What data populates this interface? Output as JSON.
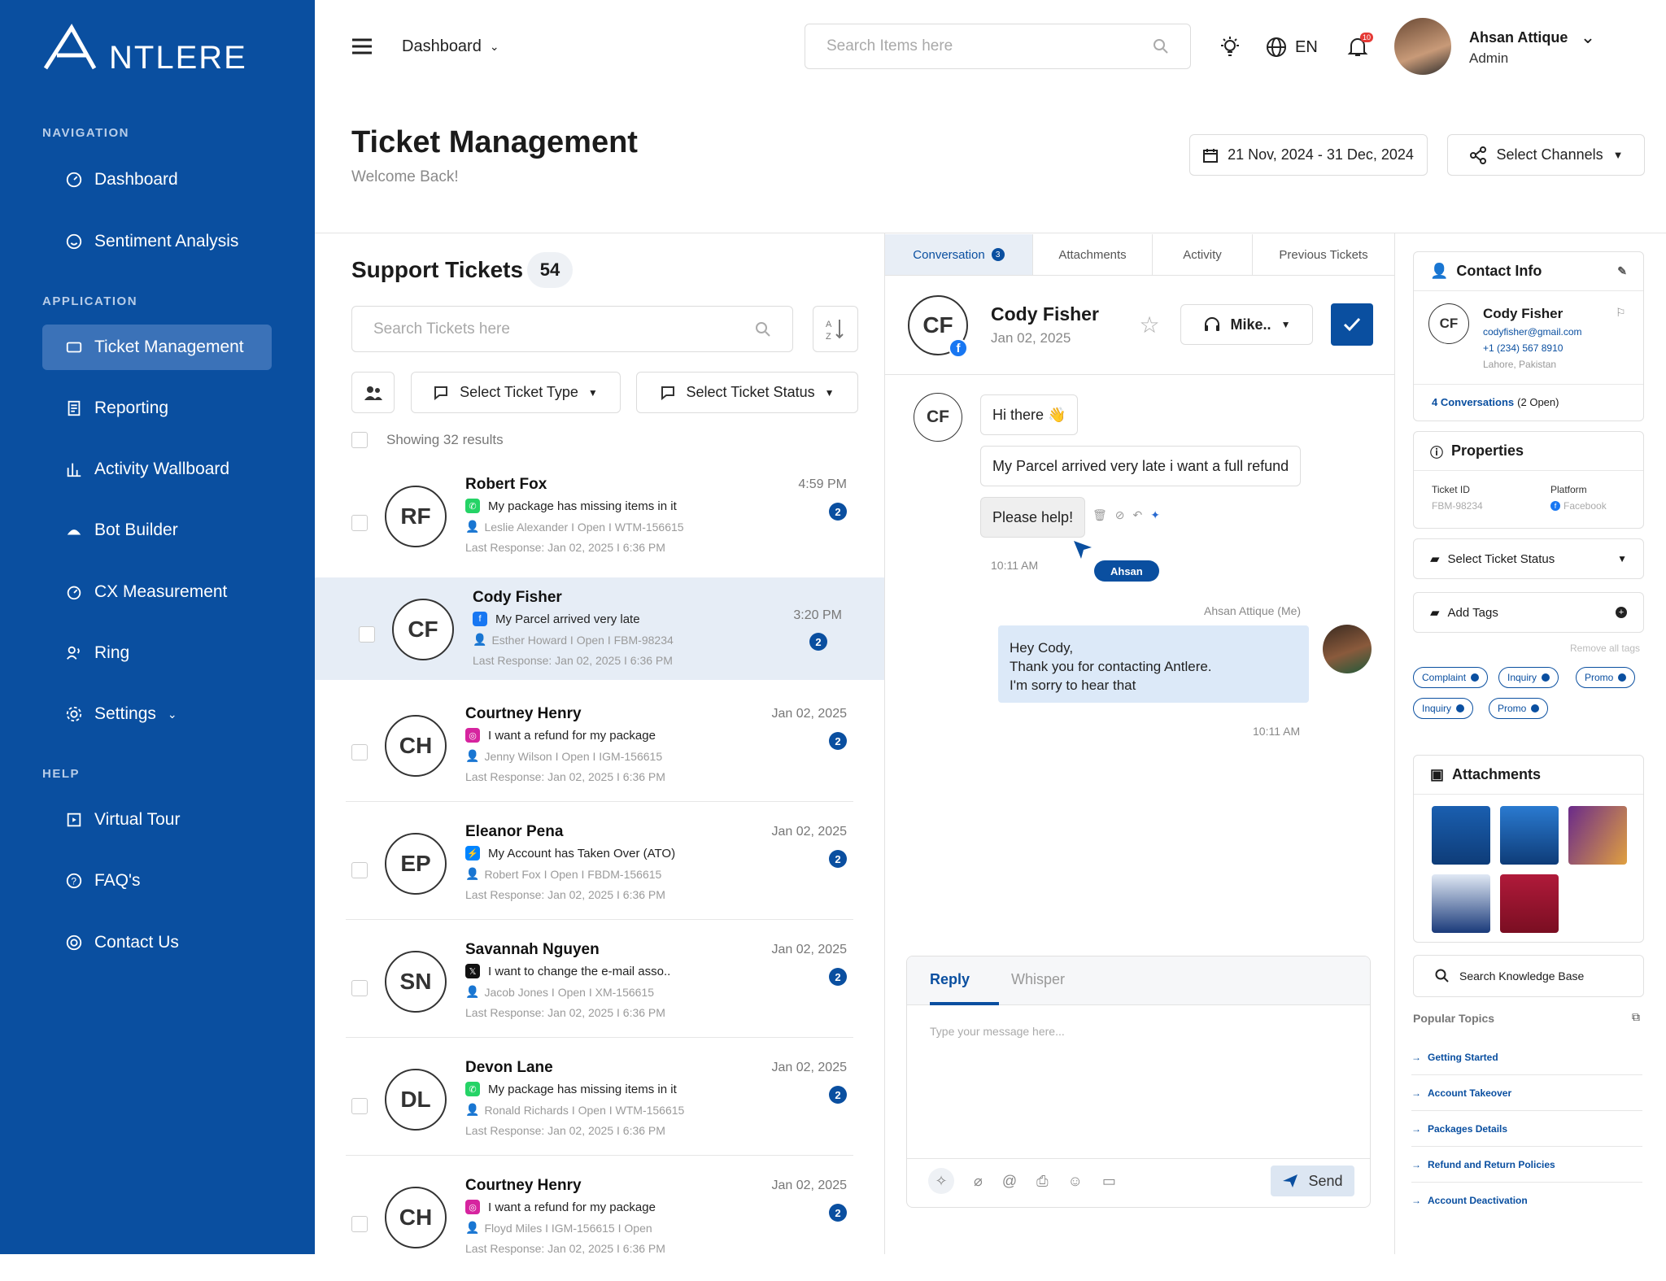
{
  "app": {
    "brand_rest": "NTLERE"
  },
  "sidebar": {
    "sec_nav": "NAVIGATION",
    "sec_app": "APPLICATION",
    "sec_help": "HELP",
    "items": [
      {
        "label": "Dashboard"
      },
      {
        "label": "Sentiment Analysis"
      },
      {
        "label": "Ticket Management"
      },
      {
        "label": "Reporting"
      },
      {
        "label": "Activity Wallboard"
      },
      {
        "label": "Bot Builder"
      },
      {
        "label": "CX Measurement"
      },
      {
        "label": "Ring"
      },
      {
        "label": "Settings"
      },
      {
        "label": "Virtual Tour"
      },
      {
        "label": "FAQ's"
      },
      {
        "label": "Contact Us"
      }
    ]
  },
  "header": {
    "dashboard": "Dashboard",
    "search_placeholder": "Search Items here",
    "lang": "EN",
    "notif_count": "10",
    "user_name": "Ahsan Attique",
    "user_role": "Admin"
  },
  "page": {
    "title": "Ticket Management",
    "subtitle": "Welcome Back!",
    "date_range": "21 Nov, 2024 - 31 Dec, 2024",
    "channels": "Select Channels"
  },
  "tickets": {
    "title": "Support Tickets",
    "count": "54",
    "search_placeholder": "Search Tickets here",
    "type_filter": "Select Ticket Type",
    "status_filter": "Select Ticket Status",
    "showing": "Showing 32 results",
    "list": [
      {
        "initials": "RF",
        "name": "Robert Fox",
        "msg": "My package has missing items  in it",
        "meta": "Leslie Alexander  I  Open  I  WTM-156615",
        "last": "Last Response:  Jan 02, 2025 I 6:36 PM",
        "time": "4:59 PM",
        "badge": "2"
      },
      {
        "initials": "CF",
        "name": "Cody Fisher",
        "msg": "My Parcel arrived very late",
        "meta": "Esther Howard  I  Open  I  FBM-98234",
        "last": "Last Response:  Jan 02, 2025 I 6:36 PM",
        "time": "3:20 PM",
        "badge": "2"
      },
      {
        "initials": "CH",
        "name": "Courtney Henry",
        "msg": "I want a refund for my package",
        "meta": "Jenny Wilson  I  Open  I  IGM-156615",
        "last": "Last Response:  Jan 02, 2025 I 6:36 PM",
        "time": "Jan 02, 2025",
        "badge": "2"
      },
      {
        "initials": "EP",
        "name": "Eleanor Pena",
        "msg": "My Account has Taken Over (ATO)",
        "meta": "Robert Fox  I  Open  I  FBDM-156615",
        "last": "Last Response:  Jan 02, 2025 I 6:36 PM",
        "time": "Jan 02, 2025",
        "badge": "2"
      },
      {
        "initials": "SN",
        "name": "Savannah Nguyen",
        "msg": "I want to change the e-mail asso..",
        "meta": "Jacob Jones  I  Open  I  XM-156615",
        "last": "Last Response:  Jan 02, 2025 I 6:36 PM",
        "time": "Jan 02, 2025",
        "badge": "2"
      },
      {
        "initials": "DL",
        "name": "Devon Lane",
        "msg": "My package has missing items  in it",
        "meta": "Ronald Richards  I  Open  I  WTM-156615",
        "last": "Last Response:  Jan 02, 2025 I 6:36 PM",
        "time": "Jan 02, 2025",
        "badge": "2"
      },
      {
        "initials": "CH",
        "name": "Courtney Henry",
        "msg": "I want a refund for my package",
        "meta": "Floyd Miles  I  IGM-156615  I  Open",
        "last": "Last Response:  Jan 02, 2025 I 6:36 PM",
        "time": "Jan 02, 2025",
        "badge": "2"
      }
    ]
  },
  "conversation": {
    "tabs": [
      "Conversation",
      "Attachments",
      "Activity",
      "Previous Tickets"
    ],
    "tab_badge": "3",
    "contact_initials": "CF",
    "contact_name": "Cody Fisher",
    "contact_date": "Jan 02, 2025",
    "agent": "Mike..",
    "msg1": "Hi there 👋",
    "msg2": "My Parcel arrived very late i want a full refund",
    "msg3": "Please help!",
    "time1": "10:11 AM",
    "cursor_label": "Ahsan",
    "me_label": "Ahsan Attique (Me)",
    "reply_l1": "Hey Cody,",
    "reply_l2": "Thank you for contacting Antlere.",
    "reply_l3": "I'm sorry to hear that",
    "time2": "10:11 AM",
    "reply_tab": "Reply",
    "whisper_tab": "Whisper",
    "input_placeholder": "Type your message here...",
    "send": "Send"
  },
  "right": {
    "contact_title": "Contact Info",
    "c_initials": "CF",
    "c_name": "Cody Fisher",
    "c_email": "codyfisher@gmail.com",
    "c_phone": "+1 (234) 567 8910",
    "c_loc": "Lahore, Pakistan",
    "conv_count": "4 Conversations",
    "conv_open": "(2 Open)",
    "props_title": "Properties",
    "ticket_id_label": "Ticket ID",
    "ticket_id": "FBM-98234",
    "platform_label": "Platform",
    "platform": "Facebook",
    "status_select": "Select Ticket Status",
    "add_tags": "Add Tags",
    "remove_tags": "Remove all tags",
    "tags": [
      "Complaint",
      "Inquiry",
      "Promo",
      "Inquiry",
      "Promo"
    ],
    "attachments_title": "Attachments",
    "kb": "Search Knowledge Base",
    "popular": "Popular Topics",
    "topics": [
      "Getting Started",
      "Account Takeover",
      "Packages Details",
      "Refund and Return Policies",
      "Account Deactivation"
    ]
  },
  "colors": {
    "brand": "#0a4fa0",
    "selected_row": "#e6edf6",
    "reply_bubble": "#dce9f8"
  }
}
